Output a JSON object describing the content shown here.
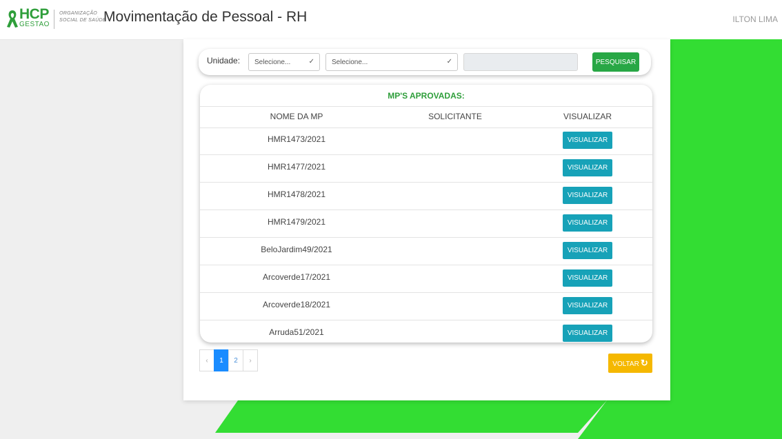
{
  "header": {
    "logo_text": "HCP",
    "logo_sub": "GESTAO",
    "org_line1": "ORGANIZAÇÃO",
    "org_line2": "SOCIAL DE SAÚDE",
    "title": "Movimentação de Pessoal - RH",
    "user": "ILTON LIMA"
  },
  "filter": {
    "unit_label": "Unidade:",
    "select1_value": "Selecione...",
    "select2_value": "Selecione...",
    "search_value": "",
    "search_button": "PESQUISAR"
  },
  "table": {
    "title": "MP'S APROVADAS:",
    "columns": [
      "NOME DA MP",
      "SOLICITANTE",
      "VISUALIZAR"
    ],
    "action_label": "VISUALIZAR",
    "rows": [
      {
        "name": "HMR1473/2021",
        "solicitante": ""
      },
      {
        "name": "HMR1477/2021",
        "solicitante": ""
      },
      {
        "name": "HMR1478/2021",
        "solicitante": ""
      },
      {
        "name": "HMR1479/2021",
        "solicitante": ""
      },
      {
        "name": "BeloJardim49/2021",
        "solicitante": ""
      },
      {
        "name": "Arcoverde17/2021",
        "solicitante": ""
      },
      {
        "name": "Arcoverde18/2021",
        "solicitante": ""
      },
      {
        "name": "Arruda51/2021",
        "solicitante": ""
      }
    ]
  },
  "pagination": {
    "prev": "‹",
    "pages": [
      "1",
      "2"
    ],
    "next": "›",
    "current": "1"
  },
  "back_button": "VOLTAR",
  "colors": {
    "brand_green": "#2e9e3a",
    "decor_green": "#33dd33",
    "search_button": "#28a745",
    "view_button": "#17a2b8",
    "back_button": "#f5b800",
    "active_page": "#1a8cff"
  }
}
